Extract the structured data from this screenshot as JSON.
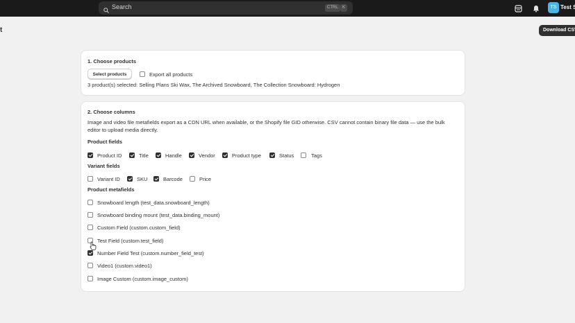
{
  "topbar": {
    "search_placeholder": "Search",
    "shortcut_ctrl": "CTRL",
    "shortcut_k": "K",
    "avatar_initials": "TS",
    "store_name": "Test S"
  },
  "page": {
    "title_fragment": "t",
    "download_label": "Download CSV"
  },
  "products_card": {
    "title": "1. Choose products",
    "select_button": "Select products",
    "export_all_label": "Export all products",
    "export_all_checked": false,
    "selected_summary": "3 product(s) selected: Selling Plans Ski Wax, The Archived Snowboard, The Collection Snowboard: Hydrogen"
  },
  "columns_card": {
    "title": "2. Choose columns",
    "description": "Image and video file metafields export as a CDN URL when available, or the Shopify file GID otherwise. CSV cannot contain binary file data — use the bulk editor to upload media directly.",
    "product_fields_title": "Product fields",
    "product_fields": [
      {
        "label": "Product ID",
        "checked": true
      },
      {
        "label": "Title",
        "checked": true
      },
      {
        "label": "Handle",
        "checked": true
      },
      {
        "label": "Vendor",
        "checked": true
      },
      {
        "label": "Product type",
        "checked": true
      },
      {
        "label": "Status",
        "checked": true
      },
      {
        "label": "Tags",
        "checked": false
      }
    ],
    "variant_fields_title": "Variant fields",
    "variant_fields": [
      {
        "label": "Variant ID",
        "checked": false
      },
      {
        "label": "SKU",
        "checked": true
      },
      {
        "label": "Barcode",
        "checked": true
      },
      {
        "label": "Price",
        "checked": false
      }
    ],
    "metafields_title": "Product metafields",
    "metafields": [
      {
        "label": "Snowboard length (test_data.snowboard_length)",
        "checked": false
      },
      {
        "label": "Snowboard binding mount (test_data.binding_mount)",
        "checked": false
      },
      {
        "label": "Custom Field (custom.custom_field)",
        "checked": false
      },
      {
        "label": "Test Field (custom.test_field)",
        "checked": false
      },
      {
        "label": "Number Field Test (custom.number_field_test)",
        "checked": true
      },
      {
        "label": "Video1 (custom.video1)",
        "checked": false
      },
      {
        "label": "Image Custom (custom.image_custom)",
        "checked": false
      }
    ]
  }
}
